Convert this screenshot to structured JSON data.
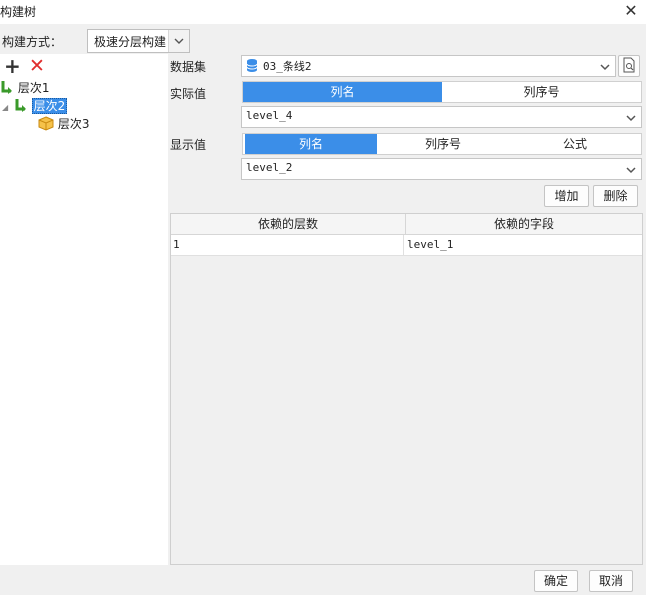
{
  "window": {
    "title": "构建树",
    "close_glyph": "✕"
  },
  "build_mode": {
    "label": "构建方式：",
    "value": "极速分层构建"
  },
  "tree": {
    "nodes": [
      {
        "label": "层次1",
        "icon": "level-icon-green"
      },
      {
        "label": "层次2",
        "icon": "level-icon-green",
        "selected": true
      },
      {
        "label": "层次3",
        "icon": "cube-icon-yellow"
      }
    ]
  },
  "dataset": {
    "label": "数据集",
    "value": "03_条线2",
    "icon": "database-icon"
  },
  "actual_value": {
    "label": "实际值",
    "tabs": [
      "列名",
      "列序号"
    ],
    "active_tab": 0,
    "field": "level_4"
  },
  "display_value": {
    "label": "显示值",
    "tabs": [
      "列名",
      "列序号",
      "公式"
    ],
    "active_tab": 0,
    "field": "level_2"
  },
  "actions": {
    "add": "增加",
    "delete": "删除"
  },
  "dependency_table": {
    "columns": [
      "依赖的层数",
      "依赖的字段"
    ],
    "rows": [
      {
        "level": "1",
        "field": "level_1"
      }
    ]
  },
  "footer": {
    "ok": "确定",
    "cancel": "取消"
  },
  "colors": {
    "accent": "#3b8ee8",
    "danger": "#e02d2d",
    "panel": "#f0f0f0"
  }
}
